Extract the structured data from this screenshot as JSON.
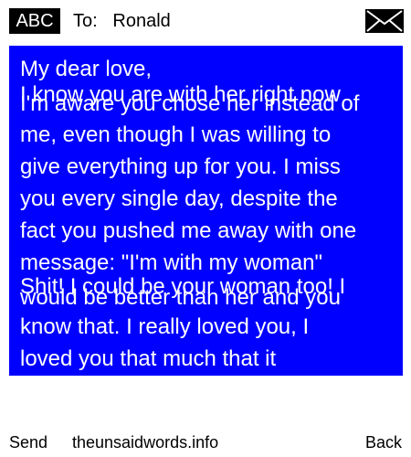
{
  "header": {
    "input_mode": "ABC",
    "to_prefix": "To:",
    "recipient": "Ronald"
  },
  "message": {
    "lines": [
      "My dear love,",
      "I know you are with her right now",
      "I'm aware you chose her instead of",
      "me, even though I was willing to",
      "give everything up for you. I miss",
      "you every single day, despite the",
      "fact you pushed me away with one",
      "message: \"I'm with my woman\"",
      "Shit! I could be your woman too! I",
      "would be better than her and you",
      "know that. I really loved you, I",
      "loved you that much that it"
    ]
  },
  "footer": {
    "left_softkey": "Send",
    "center_text": "theunsaidwords.info",
    "right_softkey": "Back"
  },
  "colors": {
    "message_background": "#0000ff",
    "message_text": "#ffffff",
    "badge_background": "#000000"
  }
}
